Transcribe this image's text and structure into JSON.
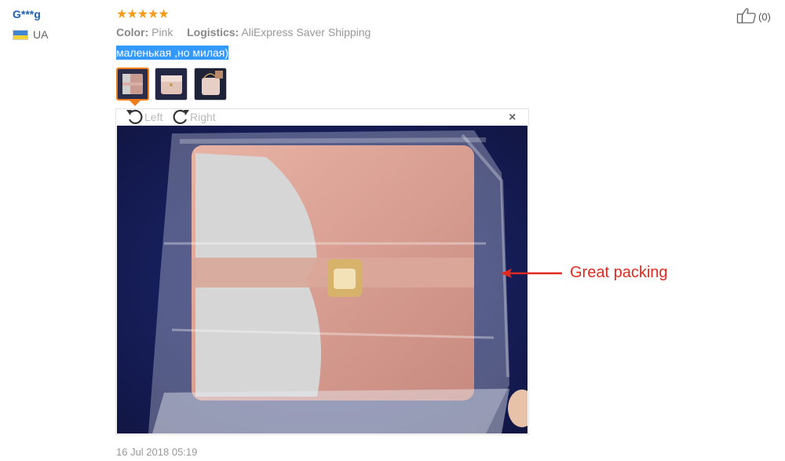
{
  "reviewer": {
    "name": "G***g",
    "country": "UA",
    "flag_colors": [
      "#3d86d3",
      "#f4d23a"
    ]
  },
  "review": {
    "rating": 5,
    "stars": "★★★★★",
    "color_label": "Color:",
    "color_value": "Pink",
    "logistics_label": "Logistics:",
    "logistics_value": "AliExpress Saver Shipping",
    "text": "маленькая ,но милая)",
    "timestamp": "16 Jul 2018 05:19"
  },
  "photo_viewer": {
    "rotate_left_label": "Left",
    "rotate_right_label": "Right",
    "close_glyph": "×",
    "thumbnail_count": 3,
    "selected_thumbnail": 1
  },
  "helpful": {
    "count_text": "(0)",
    "icon": "thumbs-up-icon"
  },
  "annotation": {
    "text": "Great packing",
    "color": "#e02a1f"
  },
  "colors": {
    "username": "#1f5fb0",
    "star": "#f59b1a",
    "highlight": "#3399ff",
    "active_thumb_border": "#f07c1a"
  }
}
